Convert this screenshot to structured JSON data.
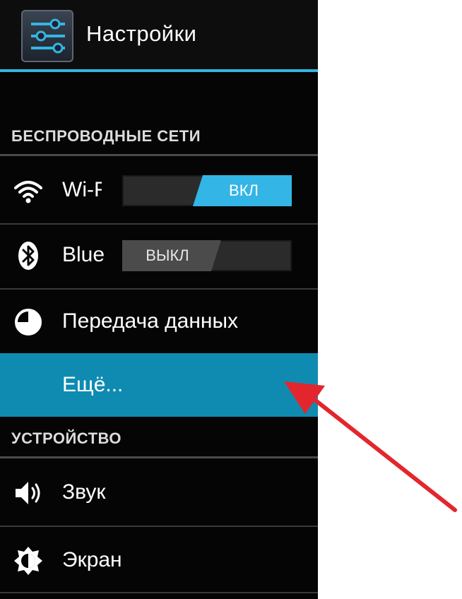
{
  "action_bar": {
    "title": "Настройки",
    "icon": "settings-sliders-icon",
    "accent_color": "#33b5e5"
  },
  "sections": {
    "wireless": "БЕСПРОВОДНЫЕ СЕТИ",
    "device": "УСТРОЙСТВО"
  },
  "items": {
    "wifi": {
      "label": "Wi-Fi",
      "icon": "wifi-icon",
      "toggle": "ВКЛ",
      "state": "on"
    },
    "bluetooth": {
      "label": "Bluetooth",
      "icon": "bluetooth-icon",
      "toggle": "ВЫКЛ",
      "state": "off"
    },
    "data_usage": {
      "label": "Передача данных",
      "icon": "data-usage-icon"
    },
    "more": {
      "label": "Ещё...",
      "selected": true,
      "highlight_color": "#0f8bb2"
    },
    "sound": {
      "label": "Звук",
      "icon": "speaker-icon"
    },
    "display": {
      "label": "Экран",
      "icon": "brightness-icon"
    }
  },
  "annotation": {
    "arrow_color": "#e3262d",
    "points_to": "more"
  }
}
